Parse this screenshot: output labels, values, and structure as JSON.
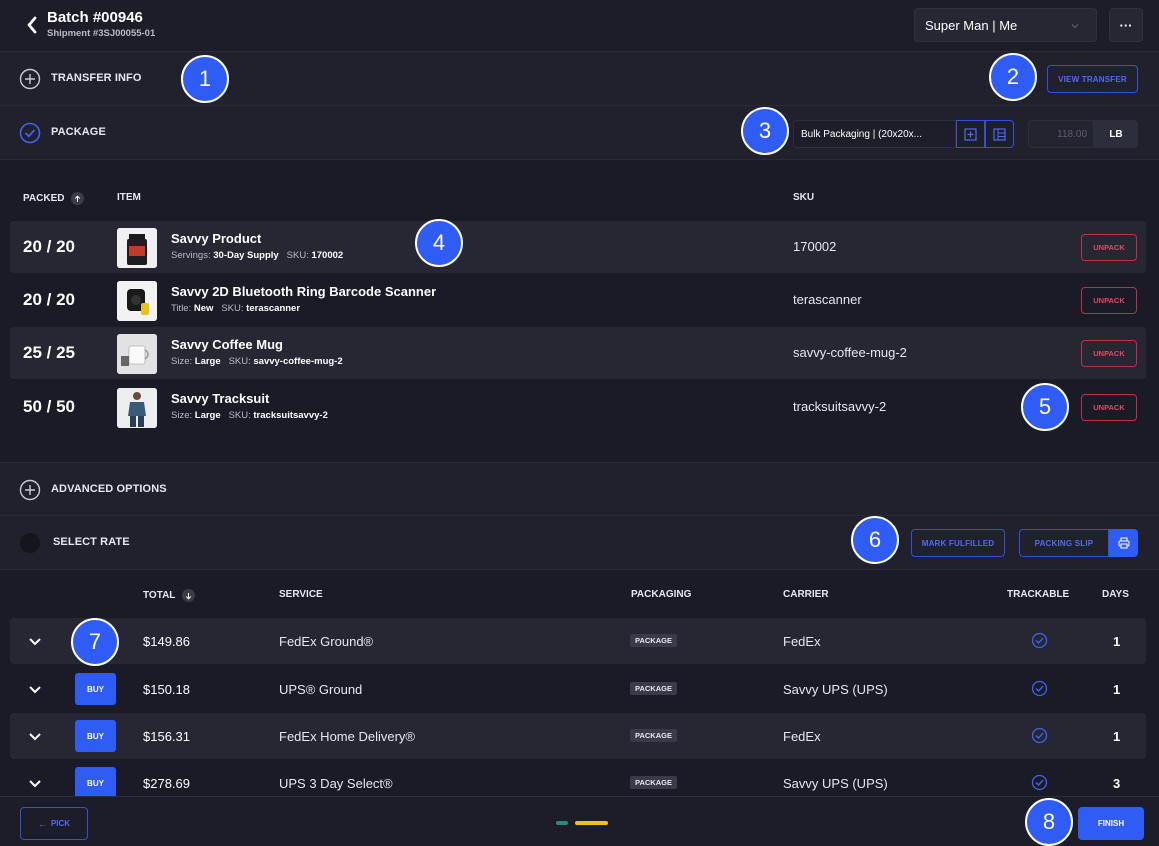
{
  "header": {
    "title": "Batch #00946",
    "subtitle": "Shipment #3SJ00055-01",
    "user_select": "Super Man | Me",
    "more_label": "···"
  },
  "transfer_info": {
    "label": "TRANSFER INFO",
    "view_transfer": "VIEW TRANSFER"
  },
  "package": {
    "label": "PACKAGE",
    "packaging_select": "Bulk Packaging | (20x20x...",
    "weight": "118.00",
    "weight_unit": "LB"
  },
  "items_table": {
    "headers": {
      "packed": "PACKED",
      "item": "ITEM",
      "sku": "SKU"
    },
    "unpack_label": "UNPACK",
    "rows": [
      {
        "packed": "20 / 20",
        "name": "Savvy Product",
        "meta_key": "Servings:",
        "meta_val": "30-Day Supply",
        "sku_key": "SKU:",
        "sku_val": "170002",
        "sku": "170002"
      },
      {
        "packed": "20 / 20",
        "name": "Savvy 2D Bluetooth Ring Barcode Scanner",
        "meta_key": "Title:",
        "meta_val": "New",
        "sku_key": "SKU:",
        "sku_val": "terascanner",
        "sku": "terascanner"
      },
      {
        "packed": "25 / 25",
        "name": "Savvy Coffee Mug",
        "meta_key": "Size:",
        "meta_val": "Large",
        "sku_key": "SKU:",
        "sku_val": "savvy-coffee-mug-2",
        "sku": "savvy-coffee-mug-2"
      },
      {
        "packed": "50 / 50",
        "name": "Savvy Tracksuit",
        "meta_key": "Size:",
        "meta_val": "Large",
        "sku_key": "SKU:",
        "sku_val": "tracksuitsavvy-2",
        "sku": "tracksuitsavvy-2"
      }
    ]
  },
  "advanced_options": {
    "label": "ADVANCED OPTIONS"
  },
  "select_rate": {
    "label": "SELECT RATE",
    "mark_fulfilled": "MARK FULFILLED",
    "packing_slip": "PACKING SLIP"
  },
  "rates_table": {
    "headers": {
      "total": "TOTAL",
      "service": "SERVICE",
      "packaging": "PACKAGING",
      "carrier": "CARRIER",
      "trackable": "TRACKABLE",
      "days": "DAYS"
    },
    "buy_label": "BUY",
    "rows": [
      {
        "total": "$149.86",
        "service": "FedEx Ground®",
        "packaging": "PACKAGE",
        "carrier": "FedEx",
        "days": "1"
      },
      {
        "total": "$150.18",
        "service": "UPS® Ground",
        "packaging": "PACKAGE",
        "carrier": "Savvy UPS (UPS)",
        "days": "1"
      },
      {
        "total": "$156.31",
        "service": "FedEx Home Delivery®",
        "packaging": "PACKAGE",
        "carrier": "FedEx",
        "days": "1"
      },
      {
        "total": "$278.69",
        "service": "UPS 3 Day Select®",
        "packaging": "PACKAGE",
        "carrier": "Savvy UPS (UPS)",
        "days": "3"
      }
    ]
  },
  "footer": {
    "pick_label": "PICK",
    "finish_label": "FINISH"
  },
  "badges": [
    "1",
    "2",
    "3",
    "4",
    "5",
    "6",
    "7",
    "8"
  ],
  "colors": {
    "accent": "#2f5cf4",
    "danger": "#e04a5f",
    "step_done": "#2a8a7a",
    "step_active": "#f2c01e"
  }
}
